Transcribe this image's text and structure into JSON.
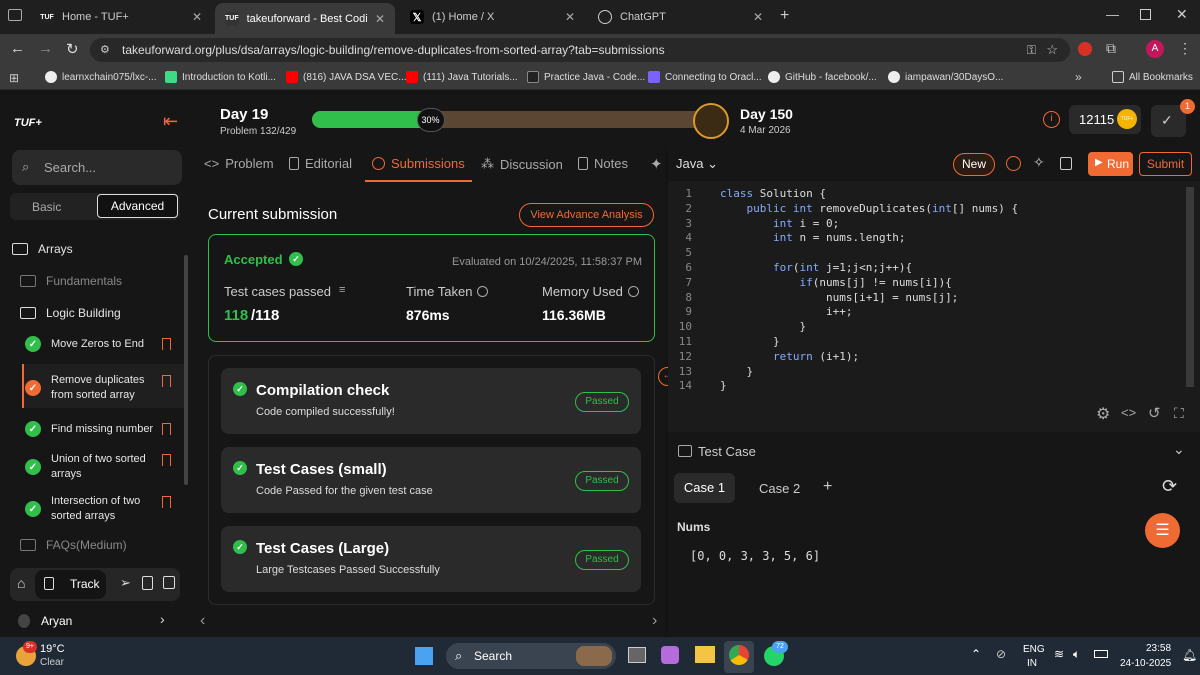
{
  "browser": {
    "tabs": [
      {
        "title": "Home - TUF+",
        "active": false
      },
      {
        "title": "takeuforward - Best Coding Tut",
        "active": true
      },
      {
        "title": "(1) Home / X",
        "active": false
      },
      {
        "title": "ChatGPT",
        "active": false
      }
    ],
    "url": "takeuforward.org/plus/dsa/arrays/logic-building/remove-duplicates-from-sorted-array?tab=submissions",
    "profile_initial": "A",
    "bookmarks": [
      "learnxchain075/lxc-...",
      "Introduction to Kotli...",
      "(816) JAVA DSA VEC...",
      "(111) Java Tutorials...",
      "Practice Java - Code...",
      "Connecting to Oracl...",
      "GitHub - facebook/...",
      "iampawan/30DaysO..."
    ],
    "all_bookmarks": "All Bookmarks",
    "more": "»"
  },
  "sidebar": {
    "logo": "TUF+",
    "search_placeholder": "Search...",
    "mode_basic": "Basic",
    "mode_advanced": "Advanced",
    "section": "Arrays",
    "sub_fundamentals": "Fundamentals",
    "sub_logic": "Logic Building",
    "items": [
      {
        "label": "Move Zeros to End"
      },
      {
        "label": "Remove duplicates from sorted array"
      },
      {
        "label": "Find missing number"
      },
      {
        "label": "Union of two sorted arrays"
      },
      {
        "label": "Intersection of two sorted arrays"
      }
    ],
    "faqs": "FAQs(Medium)",
    "track": "Track",
    "user": "Aryan"
  },
  "header": {
    "day_now": "Day 19",
    "problem_count": "Problem 132/429",
    "progress_label": "30%",
    "progress": 0.3,
    "day_goal": "Day 150",
    "goal_date": "4 Mar 2026",
    "coins": "12115",
    "coin_badge": "TUF+",
    "notif_count": "1"
  },
  "left_tabs": [
    "Problem",
    "Editorial",
    "Submissions",
    "Discussion",
    "Notes"
  ],
  "submission": {
    "heading": "Current submission",
    "advance_button": "View Advance Analysis",
    "status": "Accepted",
    "evaluated": "Evaluated on 10/24/2025, 11:58:37 PM",
    "test_label": "Test cases passed",
    "test_passed": "118",
    "test_total": "/118",
    "time_label": "Time Taken",
    "time_value": "876ms",
    "mem_label": "Memory Used",
    "mem_value": "116.36MB",
    "checks": [
      {
        "title": "Compilation check",
        "desc": "Code compiled successfully!",
        "badge": "Passed"
      },
      {
        "title": "Test Cases (small)",
        "desc": "Code Passed for the given test case",
        "badge": "Passed"
      },
      {
        "title": "Test Cases (Large)",
        "desc": "Large Testcases Passed Successfully",
        "badge": "Passed"
      }
    ]
  },
  "editor": {
    "language": "Java",
    "new_label": "New",
    "run_label": "Run",
    "submit_label": "Submit",
    "code": [
      "class Solution {",
      "    public int removeDuplicates(int[] nums) {",
      "        int i = 0;",
      "        int n = nums.length;",
      "",
      "        for(int j=1;j<n;j++){",
      "            if(nums[j] != nums[i]){",
      "                nums[i+1] = nums[j];",
      "                i++;",
      "            }",
      "        }",
      "        return (i+1);",
      "    }",
      "}"
    ]
  },
  "testcase": {
    "title": "Test Case",
    "case1": "Case 1",
    "case2": "Case 2",
    "add": "+",
    "param": "Nums",
    "value": "[0, 0, 3, 3, 5, 6]"
  },
  "taskbar": {
    "temp": "19°C",
    "weather": "Clear",
    "weather_badge": "9+",
    "search": "Search",
    "lang1": "ENG",
    "lang2": "IN",
    "time": "23:58",
    "date": "24-10-2025",
    "whatsapp_badge": "72"
  },
  "colors": {
    "accent": "#f06a33",
    "success": "#2fbf4a",
    "progress_fill": "#2fbf4a",
    "progress_track": "#5a4632"
  }
}
